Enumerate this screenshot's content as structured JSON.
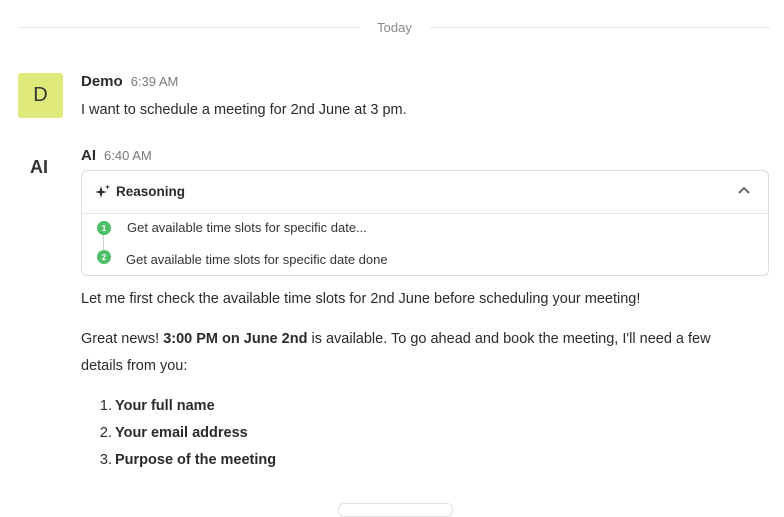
{
  "separator": {
    "label": "Today"
  },
  "messages": [
    {
      "avatar": "D",
      "avatar_color": "#dfe97a",
      "author": "Demo",
      "time": "6:39 AM",
      "text": "I want to schedule a meeting for 2nd June at 3 pm."
    },
    {
      "avatar": "AI",
      "author": "AI",
      "time": "6:40 AM",
      "reasoning": {
        "title": "Reasoning",
        "icon": "sparkle-icon",
        "toggle_icon": "chevron-up-icon",
        "steps": [
          {
            "number": "1",
            "text": "Get available time slots for specific date..."
          },
          {
            "number": "2",
            "text": "Get available time slots for specific date done"
          }
        ],
        "step_color": "#4fbf6a"
      },
      "paragraph1": "Let me first check the available time slots for 2nd June before scheduling your meeting!",
      "paragraph2_pre": "Great news! ",
      "paragraph2_bold": "3:00 PM on June 2nd",
      "paragraph2_post": " is available. To go ahead and book the meeting, I'll need a few",
      "paragraph2_line2": "details from you:",
      "list": [
        {
          "number": "1.",
          "label": "Your full name"
        },
        {
          "number": "2.",
          "label": "Your email address"
        },
        {
          "number": "3.",
          "label": "Purpose of the meeting"
        }
      ]
    }
  ]
}
